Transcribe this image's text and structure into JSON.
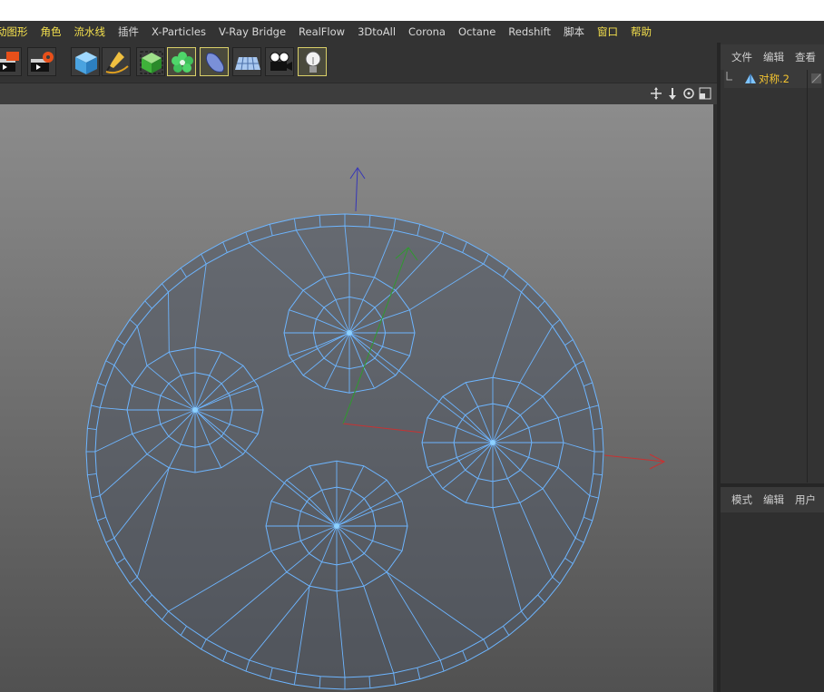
{
  "menubar": {
    "items": [
      {
        "label": "动图形",
        "highlight": true
      },
      {
        "label": "角色",
        "highlight": true
      },
      {
        "label": "流水线",
        "highlight": true
      },
      {
        "label": "插件",
        "highlight": false
      },
      {
        "label": "X-Particles",
        "highlight": false
      },
      {
        "label": "V-Ray Bridge",
        "highlight": false
      },
      {
        "label": "RealFlow",
        "highlight": false
      },
      {
        "label": "3DtoAll",
        "highlight": false
      },
      {
        "label": "Corona",
        "highlight": false
      },
      {
        "label": "Octane",
        "highlight": false
      },
      {
        "label": "Redshift",
        "highlight": false
      },
      {
        "label": "脚本",
        "highlight": false
      },
      {
        "label": "窗口",
        "highlight": true
      },
      {
        "label": "帮助",
        "highlight": true
      }
    ]
  },
  "toolbar": {
    "icons": [
      "render-region-icon",
      "render-settings-icon",
      "cube-icon",
      "pen-spline-icon",
      "subdivision-icon",
      "cloner-icon",
      "deformer-icon",
      "floor-icon",
      "camera-icon",
      "light-icon"
    ]
  },
  "object_manager": {
    "menu": [
      "文件",
      "编辑",
      "查看"
    ],
    "objects": [
      {
        "name": "对称.2",
        "icon": "symmetry-icon"
      }
    ]
  },
  "attribute_manager": {
    "menu": [
      "模式",
      "编辑",
      "用户"
    ]
  },
  "colors": {
    "mesh_edge": "#6db5ff",
    "axis_x": "#c83232",
    "axis_y": "#2f9a2f",
    "axis_z": "#3636b8",
    "active_object": "#f4c430",
    "menu_highlight": "#f4e04d"
  }
}
